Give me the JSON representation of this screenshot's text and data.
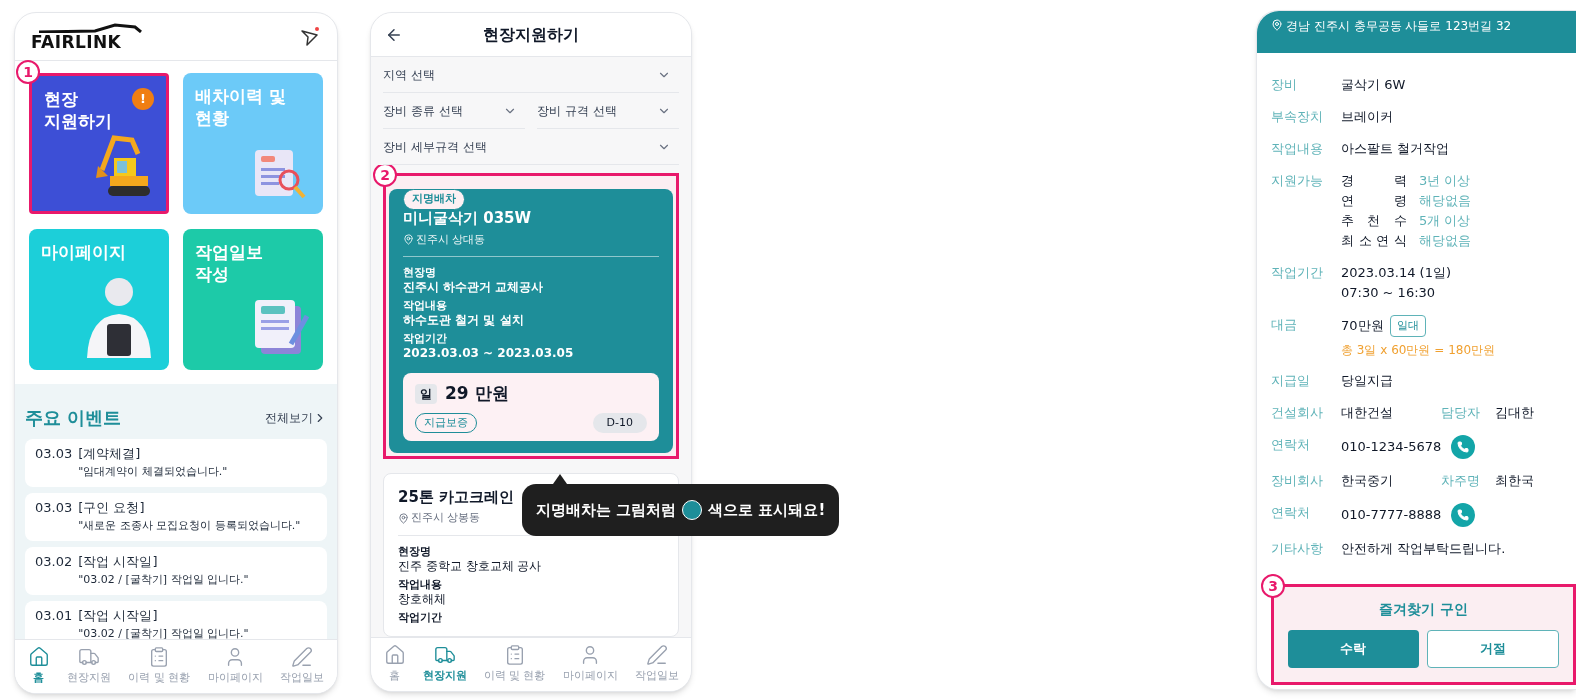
{
  "home": {
    "logo": "FAIRLINK",
    "marker": "1",
    "tiles": [
      {
        "kind": "excavator",
        "lines": [
          "현장",
          "지원하기"
        ],
        "color": "#3d4fd6",
        "badge": "!",
        "highlighted": true
      },
      {
        "kind": "search",
        "lines": [
          "배차이력 및",
          "현황"
        ],
        "color": "#6ccaf8",
        "highlighted": false
      },
      {
        "kind": "person",
        "lines": [
          "마이페이지"
        ],
        "color": "#1ccfd9",
        "highlighted": false
      },
      {
        "kind": "report",
        "lines": [
          "작업일보",
          "작성"
        ],
        "color": "#1dcaa8",
        "highlighted": false
      }
    ],
    "events_title": "주요 이벤트",
    "view_all": "전체보기",
    "events": [
      {
        "date": "03.03",
        "tag": "[계약체결]",
        "message": "\"임대계약이 체결되었습니다.\""
      },
      {
        "date": "03.03",
        "tag": "[구인 요청]",
        "message": "\"새로운 조종사 모집요청이 등록되었습니다.\""
      },
      {
        "date": "03.02",
        "tag": "[작업 시작일]",
        "message": "\"03.02 / [굴착기] 작업일 입니다.\""
      },
      {
        "date": "03.01",
        "tag": "[작업 시작일]",
        "message": "\"03.02 / [굴착기] 작업일 입니다.\""
      }
    ],
    "nav": [
      {
        "label": "홈",
        "selected": true
      },
      {
        "label": "현장지원",
        "selected": false
      },
      {
        "label": "이력 및 현황",
        "selected": false
      },
      {
        "label": "마이페이지",
        "selected": false
      },
      {
        "label": "작업일보",
        "selected": false
      }
    ]
  },
  "apply": {
    "title": "현장지원하기",
    "marker": "2",
    "filters": [
      [
        "지역 선택"
      ],
      [
        "장비 종류 선택",
        "장비 규격 선택"
      ],
      [
        "장비 세부규격 선택"
      ]
    ],
    "cards": [
      {
        "kind": "named",
        "highlighted": true,
        "tag": "지명배차",
        "title": "미니굴삭기 035W",
        "location": "진주시 상대동",
        "fields": [
          {
            "label": "현장명",
            "value": "진주시 하수관거 교체공사"
          },
          {
            "label": "작업내용",
            "value": "하수도관 철거 및 설치"
          },
          {
            "label": "작업기간",
            "value": "2023.03.03 ~ 2023.03.05"
          }
        ],
        "price_unit": "일",
        "price": "29 만원",
        "guarantee": "지급보증",
        "dday": "D-10"
      },
      {
        "kind": "normal",
        "highlighted": false,
        "title": "25톤 카고크레인",
        "location": "진주시 상봉동",
        "fields": [
          {
            "label": "현장명",
            "value": "진주 중학교 창호교체 공사"
          },
          {
            "label": "작업내용",
            "value": "창호해체"
          },
          {
            "label": "작업기간"
          }
        ]
      }
    ],
    "nav": [
      {
        "label": "홈",
        "selected": false
      },
      {
        "label": "현장지원",
        "selected": true
      },
      {
        "label": "이력 및 현황",
        "selected": false
      },
      {
        "label": "마이페이지",
        "selected": false
      },
      {
        "label": "작업일보",
        "selected": false
      }
    ]
  },
  "tooltip": {
    "before": "지명배차는 그림처럼",
    "color": "#1e8e99",
    "after": "색으로 표시돼요!"
  },
  "detail": {
    "address": "경남 진주시 충무공동 사들로 123번길 32",
    "marker": "3",
    "rows": [
      {
        "kind": "text",
        "label": "장비",
        "value": "굴삭기 6W"
      },
      {
        "kind": "text",
        "label": "부속장치",
        "value": "브레이커"
      },
      {
        "kind": "text",
        "label": "작업내용",
        "value": "아스팔트 철거작업"
      },
      {
        "kind": "list",
        "label": "지원가능",
        "items": [
          {
            "name": "경 력",
            "value": "3년 이상"
          },
          {
            "name": "연 령",
            "value": "해당없음"
          },
          {
            "name": "추 천 수",
            "value": "5개 이상"
          },
          {
            "name": "최 소 연 식",
            "value": "해당없음"
          }
        ]
      },
      {
        "kind": "lines",
        "label": "작업기간",
        "lines": [
          "2023.03.14 (1일)",
          "07:30 ~ 16:30"
        ]
      },
      {
        "kind": "pay",
        "label": "대금",
        "value": "70만원",
        "tag": "일대",
        "note": "총 3일 x 60만원 = 180만원"
      },
      {
        "kind": "text",
        "label": "지급일",
        "value": "당일지급"
      },
      {
        "kind": "pair",
        "label": "건설회사",
        "value": "대한건설",
        "label2": "담당자",
        "value2": "김대한"
      },
      {
        "kind": "phone",
        "label": "연락처",
        "value": "010-1234-5678"
      },
      {
        "kind": "pair",
        "label": "장비회사",
        "value": "한국중기",
        "label2": "차주명",
        "value2": "최한국"
      },
      {
        "kind": "phone",
        "label": "연락처",
        "value": "010-7777-8888"
      },
      {
        "kind": "text",
        "label": "기타사항",
        "value": "안전하게 작업부탁드립니다."
      }
    ],
    "footer": {
      "title": "즐겨찾기 구인",
      "buttons": [
        {
          "kind": "primary",
          "label": "수락"
        },
        {
          "kind": "secondary",
          "label": "거절"
        }
      ]
    }
  }
}
